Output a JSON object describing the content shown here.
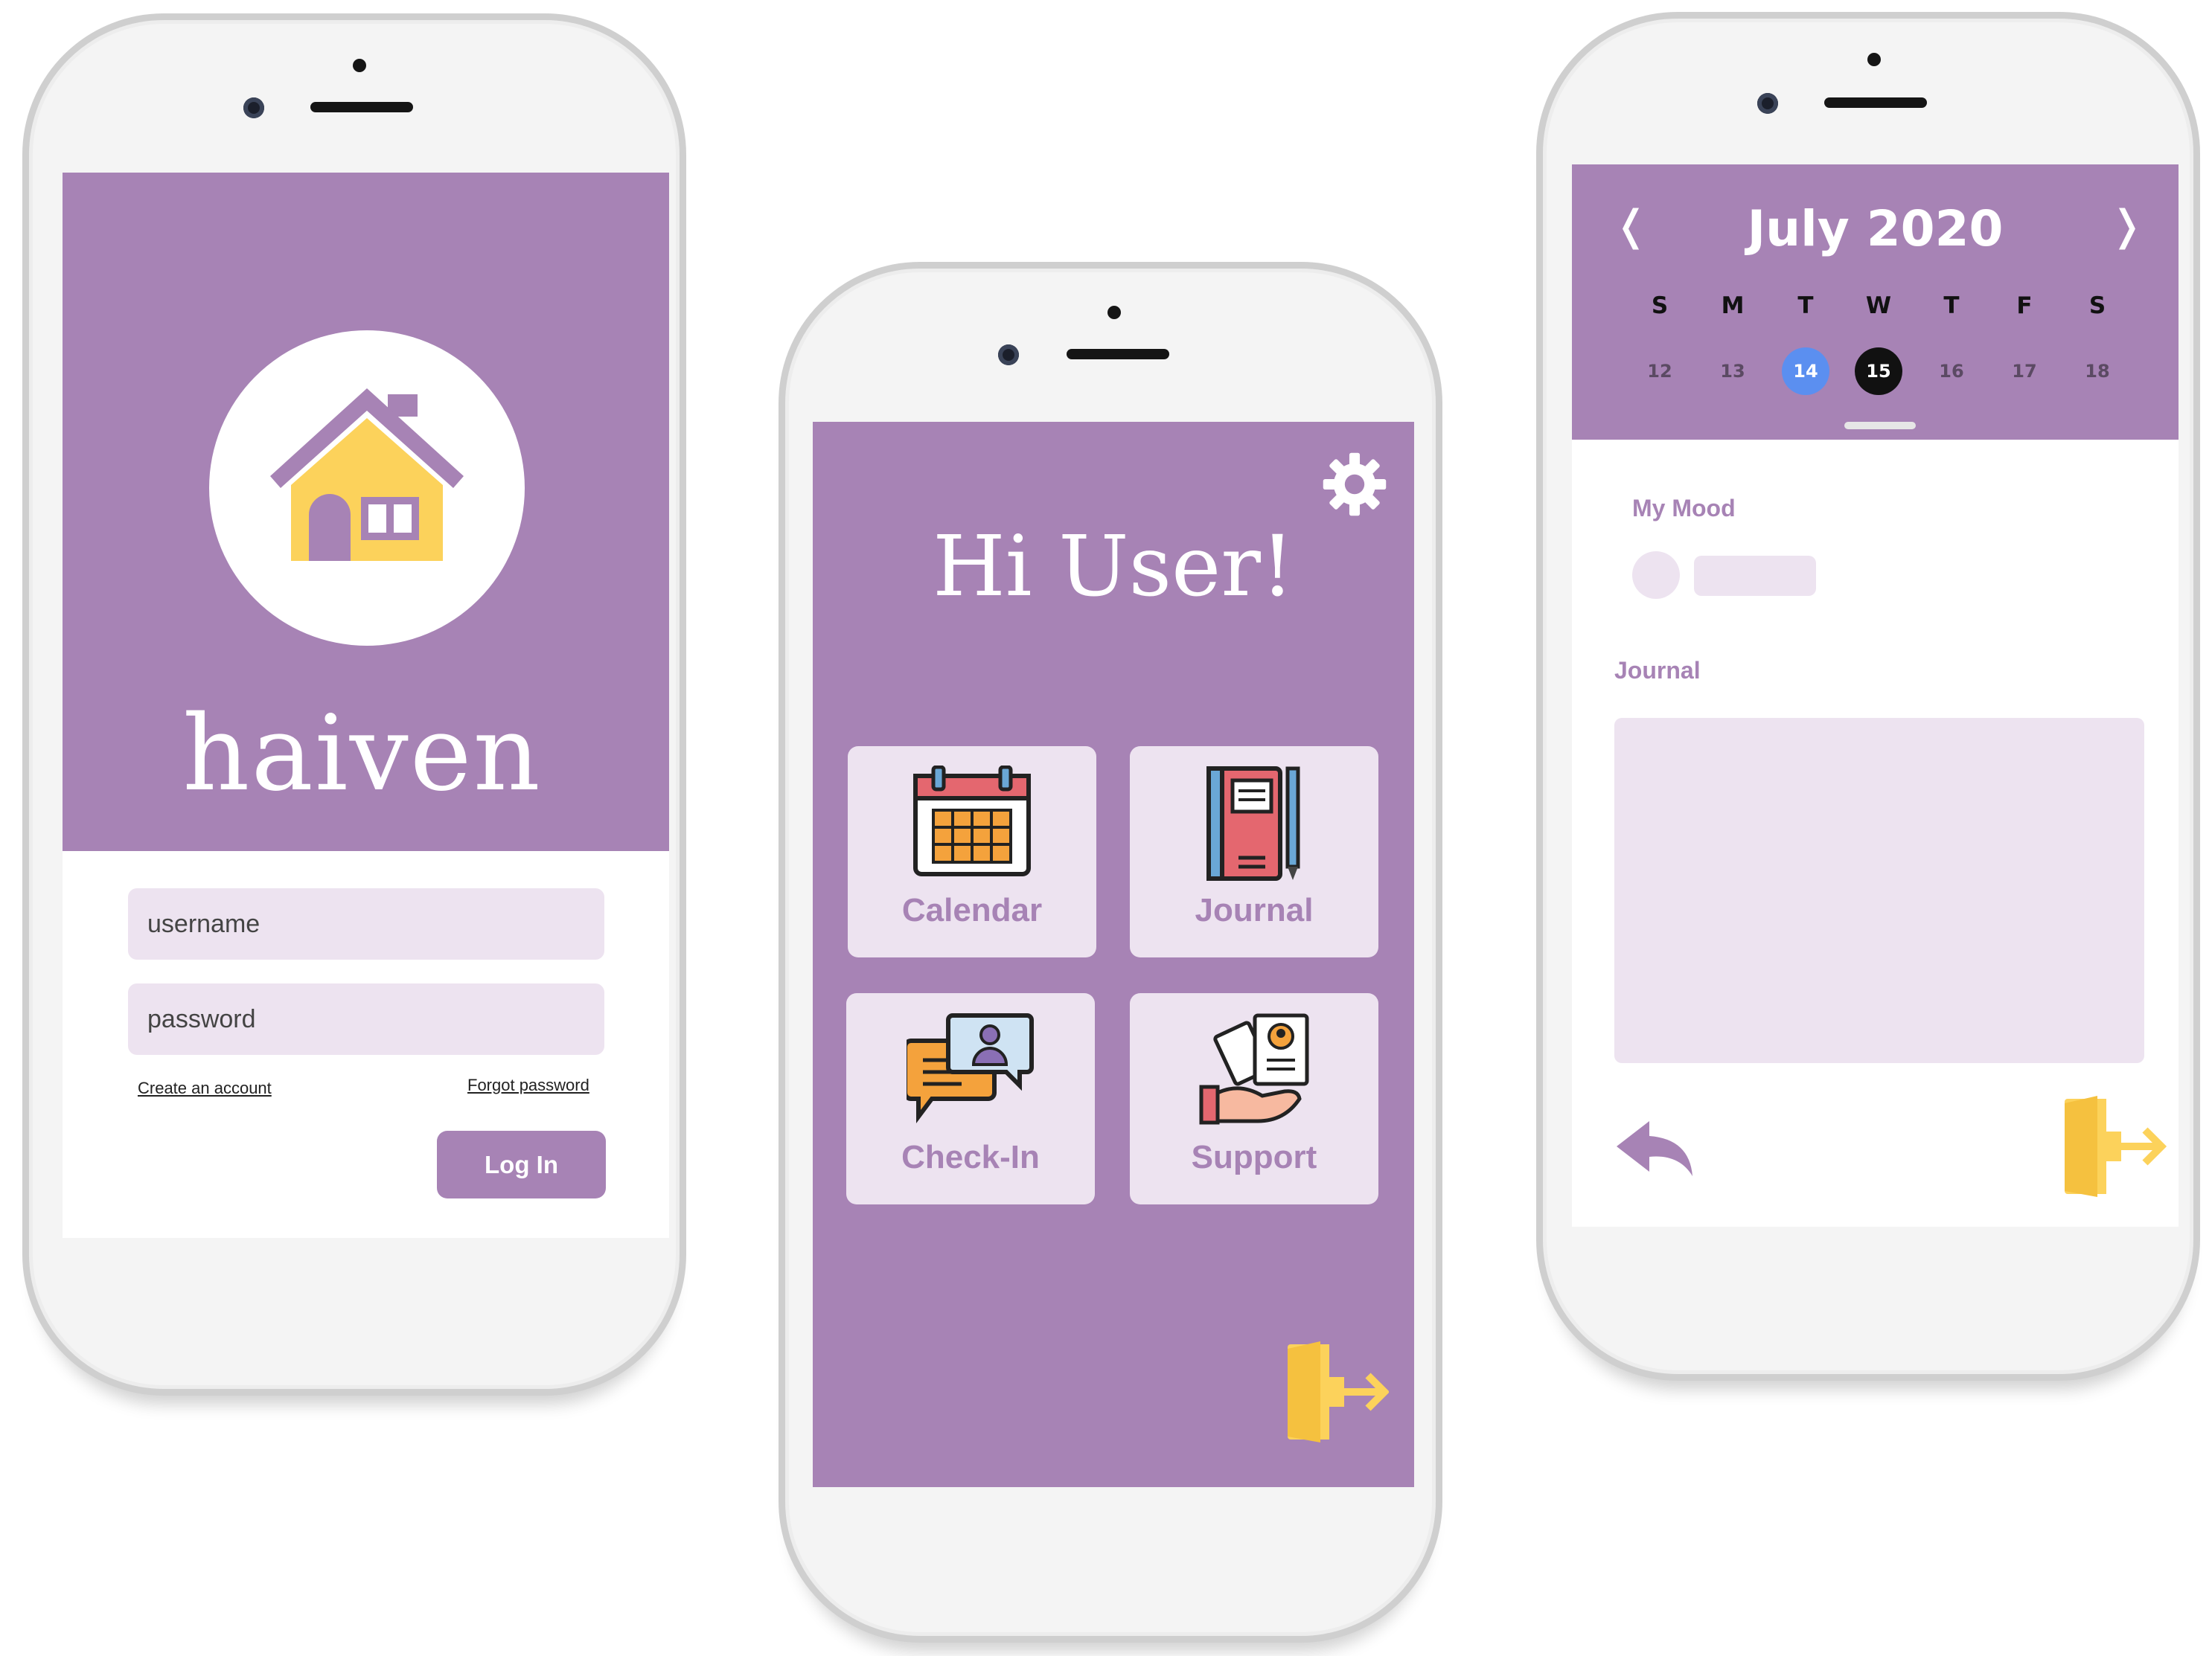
{
  "login": {
    "app_name": "haiven",
    "username_placeholder": "username",
    "password_placeholder": "password",
    "create_account": "Create an account",
    "forgot_password": "Forgot password",
    "login_button": "Log In"
  },
  "home": {
    "greeting": "Hi User!",
    "tiles": [
      {
        "label": "Calendar",
        "icon": "calendar-icon"
      },
      {
        "label": "Journal",
        "icon": "notebook-icon"
      },
      {
        "label": "Check-In",
        "icon": "chat-bubbles-icon"
      },
      {
        "label": "Support",
        "icon": "helping-hand-icon"
      }
    ],
    "settings_icon": "gear-icon",
    "exit_icon": "logout-door-icon"
  },
  "calendar": {
    "month_title": "July 2020",
    "prev": "❬",
    "next": "❭",
    "day_names": [
      "S",
      "M",
      "T",
      "W",
      "T",
      "F",
      "S"
    ],
    "days": [
      "12",
      "13",
      "14",
      "15",
      "16",
      "17",
      "18"
    ],
    "highlighted_day": "14",
    "selected_day": "15",
    "mood_label": "My Mood",
    "journal_label": "Journal",
    "back_icon": "reply-arrow-icon",
    "exit_icon": "logout-door-icon"
  },
  "colors": {
    "brand_purple": "#a783b5",
    "light_lavender": "#ede3f0",
    "accent_yellow": "#fcd25b",
    "highlight_blue": "#5b8ff0"
  }
}
